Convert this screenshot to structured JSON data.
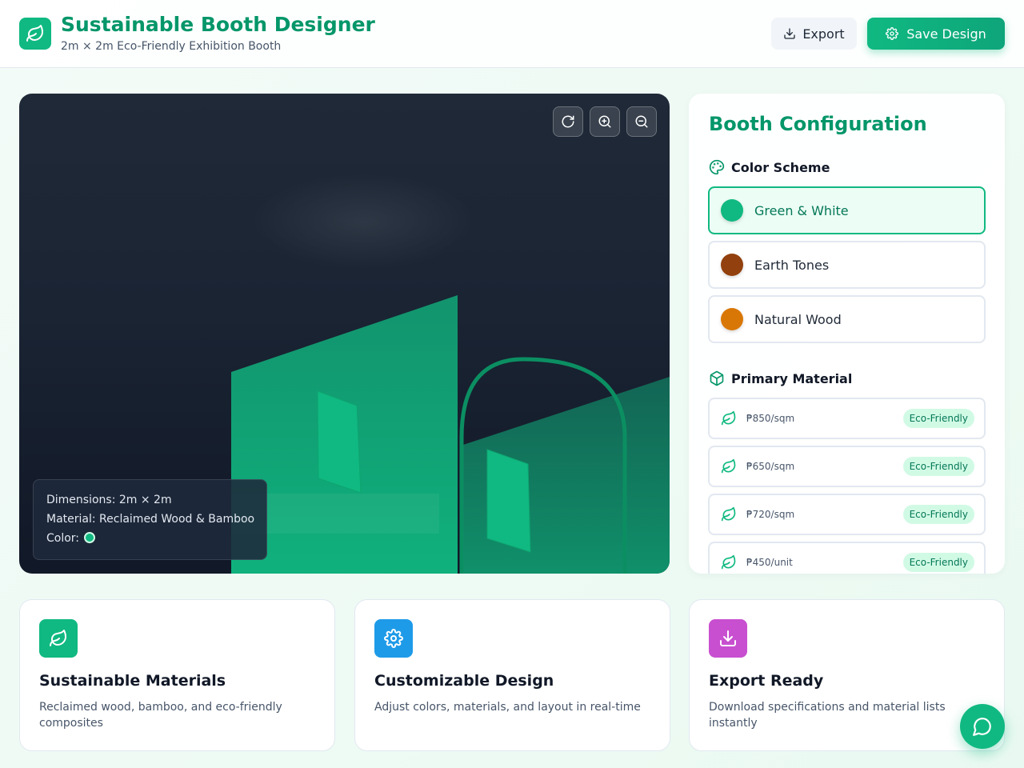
{
  "header": {
    "title": "Sustainable Booth Designer",
    "subtitle": "2m × 2m Eco-Friendly Exhibition Booth",
    "export_label": "Export",
    "save_label": "Save Design",
    "logo_icon": "leaf-icon"
  },
  "viewport": {
    "controls": [
      "refresh-icon",
      "zoom-in-icon",
      "zoom-out-icon"
    ],
    "info": {
      "dimensions": "Dimensions: 2m × 2m",
      "material": "Material: Reclaimed Wood & Bamboo",
      "color_label": "Color:"
    },
    "current_color": "#10b981"
  },
  "config": {
    "title": "Booth Configuration",
    "color_section": "Color Scheme",
    "colors": [
      {
        "label": "Green & White",
        "swatch": "#10b981",
        "selected": true
      },
      {
        "label": "Earth Tones",
        "swatch": "#92400e",
        "selected": false
      },
      {
        "label": "Natural Wood",
        "swatch": "#d97706",
        "selected": false
      }
    ],
    "material_section": "Primary Material",
    "materials": [
      {
        "price": "₱850/sqm",
        "badge": "Eco-Friendly"
      },
      {
        "price": "₱650/sqm",
        "badge": "Eco-Friendly"
      },
      {
        "price": "₱720/sqm",
        "badge": "Eco-Friendly"
      },
      {
        "price": "₱450/unit",
        "badge": "Eco-Friendly"
      }
    ]
  },
  "features": [
    {
      "icon": "leaf-icon",
      "color": "#10b981",
      "title": "Sustainable Materials",
      "desc": "Reclaimed wood, bamboo, and eco-friendly composites"
    },
    {
      "icon": "gear-icon",
      "color": "#1e9be8",
      "title": "Customizable Design",
      "desc": "Adjust colors, materials, and layout in real-time"
    },
    {
      "icon": "download-icon",
      "color": "#c84fd0",
      "title": "Export Ready",
      "desc": "Download specifications and material lists instantly"
    }
  ],
  "colors": {
    "accent": "#10b981",
    "accent_dark": "#059669"
  }
}
